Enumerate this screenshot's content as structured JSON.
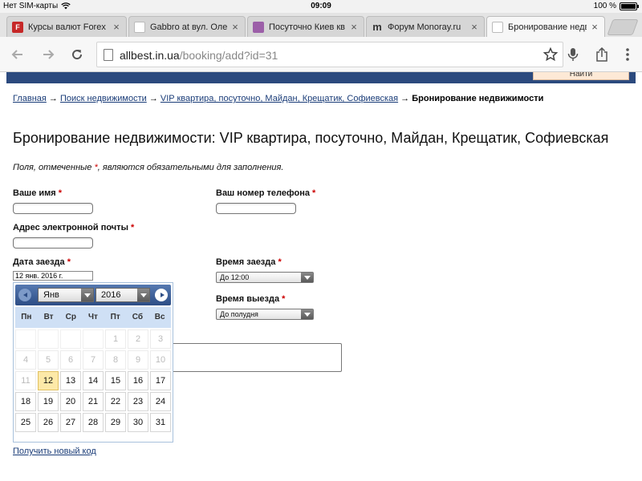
{
  "status": {
    "carrier": "Нет SIM-карты",
    "time": "09:09",
    "battery": "100 %",
    "battery_level": 1.0
  },
  "tabs": [
    {
      "label": "Курсы валют Forex",
      "favicon": "F",
      "favicon_color": "#c62828",
      "active": false
    },
    {
      "label": "Gabbro at вул. Олен",
      "favicon": "",
      "favicon_color": "#ffffff",
      "active": false
    },
    {
      "label": "Посуточно Киев кв",
      "favicon": "",
      "favicon_color": "#9c5fa8",
      "active": false
    },
    {
      "label": "Форум Monoray.ru",
      "favicon": "m",
      "favicon_color": "#333333",
      "active": false
    },
    {
      "label": "Бронирование недв",
      "favicon": "",
      "favicon_color": "#ffffff",
      "active": true
    }
  ],
  "toolbar": {
    "url_host": "allbest.in.ua",
    "url_path": "/booking/add?id=31"
  },
  "site": {
    "find_button": "Найти"
  },
  "breadcrumb": {
    "home": "Главная",
    "sep": " → ",
    "search": "Поиск недвижимости",
    "listing": "VIP квартира, посуточно, Майдан, Крещатик, Софиевская",
    "current": "Бронирование недвижимости"
  },
  "page": {
    "title": "Бронирование недвижимости: VIP квартира, посуточно, Майдан, Крещатик, Софиевская",
    "required_note_a": "Поля, отмеченные ",
    "required_note_b": ", являются обязательными для заполнения.",
    "asterisk": "*"
  },
  "form": {
    "name_label": "Ваше имя",
    "phone_label": "Ваш номер телефона",
    "email_label": "Адрес электронной почты",
    "checkin_date_label": "Дата заезда",
    "checkin_date_value": "12 янв. 2016 г.",
    "checkin_time_label": "Время заезда",
    "checkin_time_value": "До 12:00",
    "checkout_time_label": "Время выезда",
    "checkout_time_value": "До полудня",
    "new_code_link": "Получить новый код"
  },
  "datepicker": {
    "month": "Янв",
    "year": "2016",
    "weekdays": [
      "Пн",
      "Вт",
      "Ср",
      "Чт",
      "Пт",
      "Сб",
      "Вс"
    ],
    "weeks": [
      [
        "",
        "",
        "",
        "",
        "1",
        "2",
        "3"
      ],
      [
        "4",
        "5",
        "6",
        "7",
        "8",
        "9",
        "10"
      ],
      [
        "11",
        "12",
        "13",
        "14",
        "15",
        "16",
        "17"
      ],
      [
        "18",
        "19",
        "20",
        "21",
        "22",
        "23",
        "24"
      ],
      [
        "25",
        "26",
        "27",
        "28",
        "29",
        "30",
        "31"
      ]
    ],
    "today": "12",
    "last_disabled": "11"
  }
}
